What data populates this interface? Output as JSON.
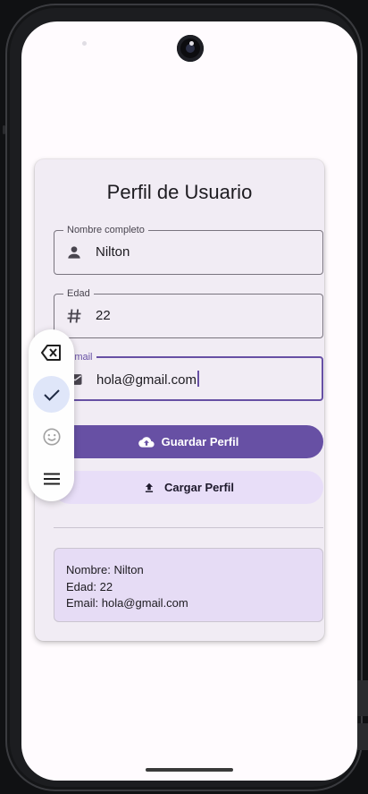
{
  "card": {
    "title": "Perfil de Usuario"
  },
  "fields": {
    "name": {
      "label": "Nombre completo",
      "value": "Nilton",
      "icon": "person-icon"
    },
    "age": {
      "label": "Edad",
      "value": "22",
      "icon": "hash-icon"
    },
    "email": {
      "label": "Email",
      "value": "hola@gmail.com",
      "icon": "email-icon",
      "focused": true
    }
  },
  "buttons": {
    "save": {
      "label": "Guardar Perfil",
      "icon": "cloud-upload-icon"
    },
    "load": {
      "label": "Cargar Perfil",
      "icon": "upload-icon"
    }
  },
  "summary": {
    "name_line": "Nombre: Nilton",
    "age_line": "Edad: 22",
    "email_line": "Email: hola@gmail.com"
  },
  "keyboard_toolbar": {
    "items": [
      "backspace-icon",
      "check-icon",
      "emoji-icon",
      "menu-icon"
    ],
    "active": "check-icon"
  },
  "colors": {
    "primary": "#6750a4",
    "secondary_container": "#e8def8",
    "card_background": "#f1ecf4",
    "summary_background": "#e6dcf5"
  }
}
